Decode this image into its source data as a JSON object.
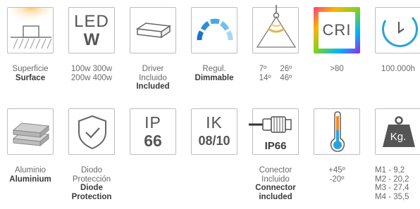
{
  "row1": {
    "surface": {
      "line1": "Superficie",
      "line2": "Surface"
    },
    "led": {
      "top": "LED",
      "bottom": "W",
      "line1": "100w 300w",
      "line2": "200w 400w"
    },
    "driver": {
      "line1": "Driver",
      "line2": "Incluido",
      "line3": "Included"
    },
    "dimmable": {
      "line1": "Regul.",
      "line2": "Dimmable"
    },
    "angle": {
      "line1": "7º      26º",
      "line2": "14º    46º"
    },
    "cri": {
      "text": "CRI",
      "line1": ">80"
    },
    "hours": {
      "line1": "100.000h"
    }
  },
  "row2": {
    "aluminium": {
      "line1": "Aluminio",
      "line2": "Aluminium"
    },
    "diode": {
      "line1": "Diodo",
      "line2": "Protección",
      "line3": "Diode",
      "line4": "Protection"
    },
    "ip": {
      "top": "IP",
      "bottom": "66"
    },
    "ik": {
      "top": "IK",
      "bottom": "08/10"
    },
    "connector": {
      "badge": "IP66",
      "line1": "Conector",
      "line2": "Incluido",
      "line3": "Connector",
      "line4": "included"
    },
    "temp": {
      "line1": "+45º",
      "line2": "-20º"
    },
    "weight": {
      "badge": "Kg.",
      "lines": [
        "M1 - 9,2",
        "M2 - 20,2",
        "M3 - 27,4",
        "M4 - 35,5"
      ]
    }
  },
  "colors": {
    "border": "#bdbdbd",
    "accent_blue": "#29a3dc",
    "text": "#4a4a4a"
  }
}
